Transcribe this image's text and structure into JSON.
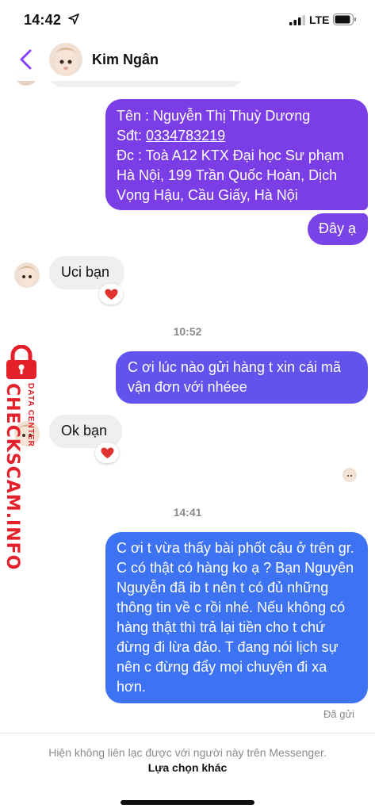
{
  "status_bar": {
    "time": "14:42",
    "network": "LTE"
  },
  "header": {
    "contact_name": "Kim Ngân"
  },
  "messages": [
    {
      "direction": "outgoing",
      "lines": [
        "Tên : Nguyễn Thị Thuỳ Dương",
        "Sđt: ",
        "Đc : Toà A12 KTX Đại học Sư phạm",
        "Hà Nội, 199 Trần Quốc Hoàn, Dịch",
        "Vọng Hậu, Cầu Giấy, Hà Nội"
      ],
      "phone_link": "0334783219"
    },
    {
      "direction": "outgoing",
      "text": "Đây ạ"
    },
    {
      "direction": "incoming",
      "text": "Uci bạn",
      "reaction": "heart"
    },
    {
      "direction": "outgoing",
      "text": "C ơi lúc nào gửi hàng t xin cái mã vận đơn với nhéee"
    },
    {
      "direction": "incoming",
      "text": "Ok bạn",
      "reaction": "heart"
    },
    {
      "direction": "outgoing",
      "text": "C ơi t vừa thấy bài phốt cậu ở trên gr. C có thật có hàng ko ạ ? Bạn Nguyên Nguyễn đã ib t nên t có đủ những thông tin về c rồi nhé. Nếu không có hàng thật thì trả lại tiền cho t chứ đừng đi lừa đảo. T đang nói lịch sự nên c đừng đẩy mọi chuyện đi xa hơn."
    }
  ],
  "timestamps": [
    "10:52",
    "14:41"
  ],
  "seen_label": "Đã gửi",
  "footer": {
    "note": "Hiện không liên lạc được với người này trên Messenger.",
    "link": "Lựa chọn khác"
  },
  "watermark": {
    "main": "CHECKSCAM.INFO",
    "sub": "DATA CENTER"
  },
  "colors": {
    "bubble_purple": "#7b3ee6",
    "bubble_indigo": "#6253ec",
    "bubble_blue": "#3d72f3",
    "accent": "#8a3ffc",
    "watermark_red": "#e4202b"
  }
}
